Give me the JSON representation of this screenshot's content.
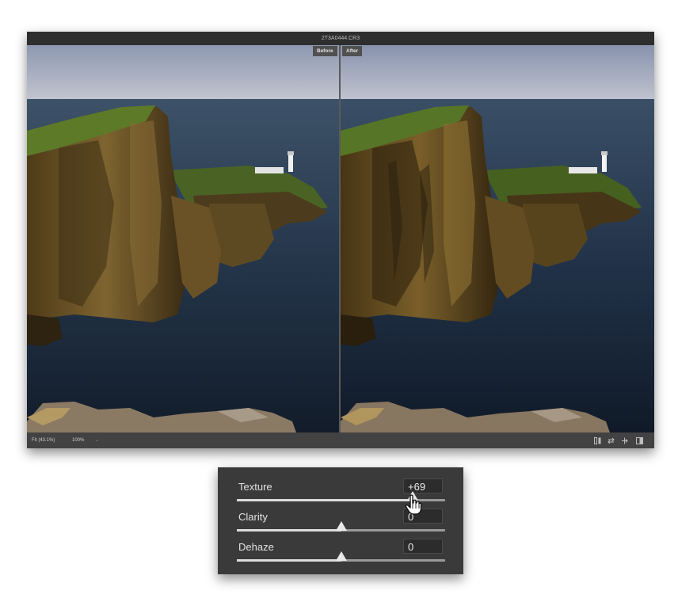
{
  "window": {
    "title": "2T3A0444.CR3",
    "before_label": "Before",
    "after_label": "After"
  },
  "statusbar": {
    "fit_label": "Fit (43.1%)",
    "zoom_label": "100%",
    "zoom_caret": "⌄",
    "view_icons": [
      "before-after-toggle-icon",
      "swap-settings-icon",
      "copy-settings-icon",
      "toggle-view-icon"
    ]
  },
  "panel": {
    "sliders": [
      {
        "label": "Texture",
        "value": "+69",
        "position": 0.845
      },
      {
        "label": "Clarity",
        "value": "0",
        "position": 0.5
      },
      {
        "label": "Dehaze",
        "value": "0",
        "position": 0.5
      }
    ]
  },
  "colors": {
    "window_bg": "#3c3c3c",
    "panel_bg": "#3a3a3a",
    "sky": "#9aa6ba",
    "sea": "#1f2d3e",
    "cliff": "#6b5426",
    "grass": "#4f6a22"
  },
  "icons": {
    "cursor": "hand-pointer-icon",
    "slider_thumb": "slider-thumb-icon"
  }
}
